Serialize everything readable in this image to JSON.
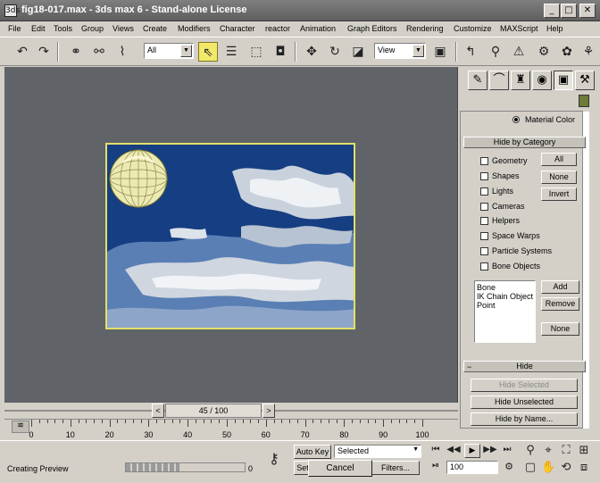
{
  "window": {
    "title": "fig18-017.max - 3ds max 6 - Stand-alone License",
    "app_icon": "3ds",
    "controls": [
      "_",
      "□",
      "✕"
    ]
  },
  "menu": [
    "File",
    "Edit",
    "Tools",
    "Group",
    "Views",
    "Create",
    "Modifiers",
    "Character",
    "reactor",
    "Animation",
    "Graph Editors",
    "Rendering",
    "Customize",
    "MAXScript",
    "Help"
  ],
  "toolbar": {
    "selection_filter": "All",
    "reference_coord": "View"
  },
  "command_panel": {
    "material_color_label": "Material Color",
    "hide_by_category": {
      "header": "Hide by Category",
      "items": [
        "Geometry",
        "Shapes",
        "Lights",
        "Cameras",
        "Helpers",
        "Space Warps",
        "Particle Systems",
        "Bone Objects"
      ],
      "all_label": "All",
      "none_label": "None",
      "invert_label": "Invert",
      "list_items": [
        "Bone",
        "IK Chain Object",
        "Point"
      ],
      "add_label": "Add",
      "remove_label": "Remove",
      "none2_label": "None"
    },
    "hide": {
      "header": "Hide",
      "hide_selected": "Hide Selected",
      "hide_unselected": "Hide Unselected",
      "hide_by_name": "Hide by Name..."
    }
  },
  "time_slider": {
    "value": "45 / 100",
    "prev": "<",
    "next": ">"
  },
  "timeline": {
    "ticks": [
      "0",
      "10",
      "20",
      "30",
      "40",
      "50",
      "60",
      "70",
      "80",
      "90",
      "100"
    ]
  },
  "status": {
    "message": "Creating Preview",
    "progress": 0.45,
    "progress_value": "0",
    "auto_key": "Auto Key",
    "key_mode": "Selected",
    "set_key": "Set",
    "filters": "Filters...",
    "cancel": "Cancel",
    "frame_field": "100"
  },
  "colors": {
    "viewport_bg": "#606468",
    "scene_border": "#e3e06a",
    "active_tool": "#f2e86a"
  }
}
